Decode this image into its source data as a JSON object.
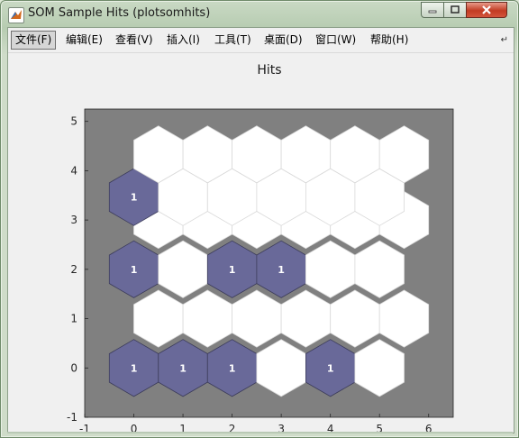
{
  "window": {
    "title": "SOM Sample Hits (plotsomhits)"
  },
  "menu": {
    "items": [
      "文件(F)",
      "编辑(E)",
      "查看(V)",
      "插入(I)",
      "工具(T)",
      "桌面(D)",
      "窗口(W)",
      "帮助(H)"
    ],
    "active_index": 0,
    "overflow_icon": "arrow-icon"
  },
  "colors": {
    "axes_background": "#808080",
    "empty_hex": "#ffffff",
    "hit_hex": "#696999",
    "hit_stroke": "#3c3c5a",
    "empty_stroke": "#d9d9d9",
    "figure_background": "#f0f0f0"
  },
  "chart_data": {
    "type": "heatmap",
    "title": "Hits",
    "xlabel": "",
    "ylabel": "",
    "xlim": [
      -1,
      6.5
    ],
    "ylim": [
      -1,
      5.25
    ],
    "xticks": [
      -1,
      0,
      1,
      2,
      3,
      4,
      5,
      6
    ],
    "yticks": [
      -1,
      0,
      1,
      2,
      3,
      4,
      5
    ],
    "grid": false,
    "legend": "none",
    "layout": "hexagonal",
    "grid_size": [
      6,
      6
    ],
    "neurons": [
      {
        "x": 0,
        "y": 0,
        "hits": 1
      },
      {
        "x": 1,
        "y": 0,
        "hits": 1
      },
      {
        "x": 2,
        "y": 0,
        "hits": 1
      },
      {
        "x": 3,
        "y": 0,
        "hits": 0
      },
      {
        "x": 4,
        "y": 0,
        "hits": 1
      },
      {
        "x": 5,
        "y": 0,
        "hits": 0
      },
      {
        "x": 0.5,
        "y": 1,
        "hits": 0
      },
      {
        "x": 1.5,
        "y": 1,
        "hits": 0
      },
      {
        "x": 2.5,
        "y": 1,
        "hits": 0
      },
      {
        "x": 3.5,
        "y": 1,
        "hits": 0
      },
      {
        "x": 4.5,
        "y": 1,
        "hits": 0
      },
      {
        "x": 5.5,
        "y": 1,
        "hits": 0
      },
      {
        "x": 0,
        "y": 2,
        "hits": 1
      },
      {
        "x": 1,
        "y": 2,
        "hits": 0
      },
      {
        "x": 2,
        "y": 2,
        "hits": 1
      },
      {
        "x": 3,
        "y": 2,
        "hits": 1
      },
      {
        "x": 4,
        "y": 2,
        "hits": 0
      },
      {
        "x": 5,
        "y": 2,
        "hits": 0
      },
      {
        "x": 0.5,
        "y": 3,
        "hits": 0
      },
      {
        "x": 1.5,
        "y": 3,
        "hits": 0
      },
      {
        "x": 2.5,
        "y": 3,
        "hits": 0
      },
      {
        "x": 3.5,
        "y": 3,
        "hits": 0
      },
      {
        "x": 4.5,
        "y": 3,
        "hits": 0
      },
      {
        "x": 5.5,
        "y": 3,
        "hits": 0
      },
      {
        "x": 0,
        "y": 3.464,
        "hits": 1
      },
      {
        "x": 1,
        "y": 3.464,
        "hits": 0
      },
      {
        "x": 2,
        "y": 3.464,
        "hits": 0
      },
      {
        "x": 3,
        "y": 3.464,
        "hits": 0
      },
      {
        "x": 4,
        "y": 3.464,
        "hits": 0
      },
      {
        "x": 5,
        "y": 3.464,
        "hits": 0
      },
      {
        "x": 0.5,
        "y": 4.33,
        "hits": 0
      },
      {
        "x": 1.5,
        "y": 4.33,
        "hits": 0
      },
      {
        "x": 2.5,
        "y": 4.33,
        "hits": 0
      },
      {
        "x": 3.5,
        "y": 4.33,
        "hits": 0
      },
      {
        "x": 4.5,
        "y": 4.33,
        "hits": 0
      },
      {
        "x": 5.5,
        "y": 4.33,
        "hits": 0
      }
    ]
  }
}
